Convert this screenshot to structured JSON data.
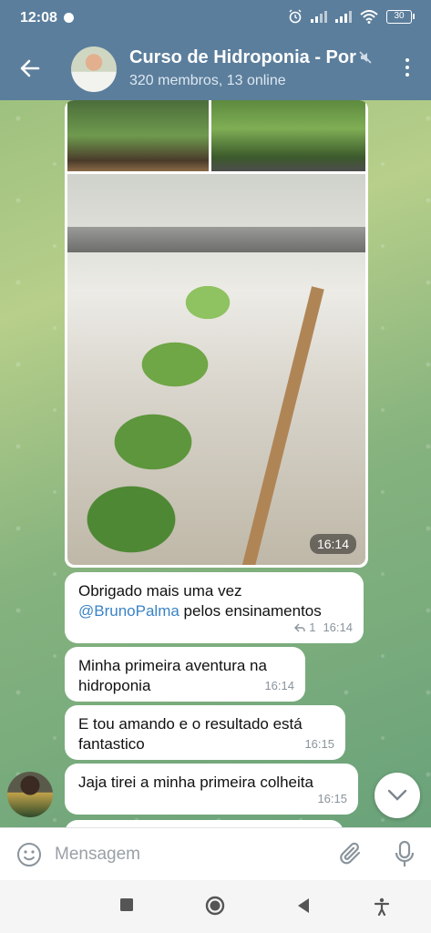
{
  "status_bar": {
    "time": "12:08",
    "battery": "30"
  },
  "header": {
    "title": "Curso de Hidroponia - Por",
    "subtitle": "320 membros, 13 online"
  },
  "messages": {
    "photo_time": "16:14",
    "m1": {
      "text_before": "Obrigado mais uma vez",
      "mention": "@BrunoPalma",
      "text_after": " pelos ensinamentos",
      "reply_count": "1",
      "time": "16:14"
    },
    "m2": {
      "text": "Minha primeira aventura na hidroponia",
      "time": "16:14"
    },
    "m3": {
      "text": "E tou amando e o resultado está fantastico",
      "time": "16:15"
    },
    "m4": {
      "text": "Jaja tirei a minha primeira colheita",
      "time": "16:15"
    }
  },
  "input": {
    "placeholder": "Mensagem"
  },
  "colors": {
    "header": "#5b7e9c",
    "mention": "#3a83c5"
  }
}
